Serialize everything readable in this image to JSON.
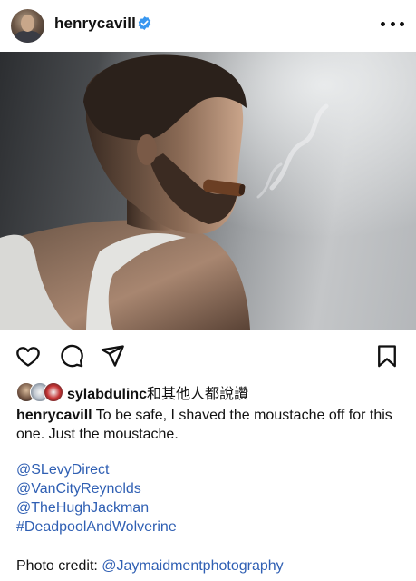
{
  "post": {
    "username": "henrycavill",
    "avatar": "profile-avatar",
    "verified_icon": "verified-badge-icon",
    "more_icon": "more-options-icon"
  },
  "actions": {
    "like_icon": "heart-icon",
    "comment_icon": "comment-icon",
    "share_icon": "send-icon",
    "save_icon": "bookmark-icon"
  },
  "likes": {
    "liked_by_user": "sylabdulinc",
    "suffix": "和其他人都說讚"
  },
  "caption": {
    "author": "henrycavill",
    "text": "To be safe, I shaved the moustache off for this one. Just the moustache.",
    "mentions": [
      "@SLevyDirect",
      "@VanCityReynolds",
      "@TheHughJackman",
      "#DeadpoolAndWolverine"
    ],
    "credit_label": "Photo credit:",
    "credit_handle": "@Jaymaidmentphotography"
  },
  "colors": {
    "link": "#2f5fb3",
    "verified": "#3897f0",
    "text": "#111111"
  }
}
